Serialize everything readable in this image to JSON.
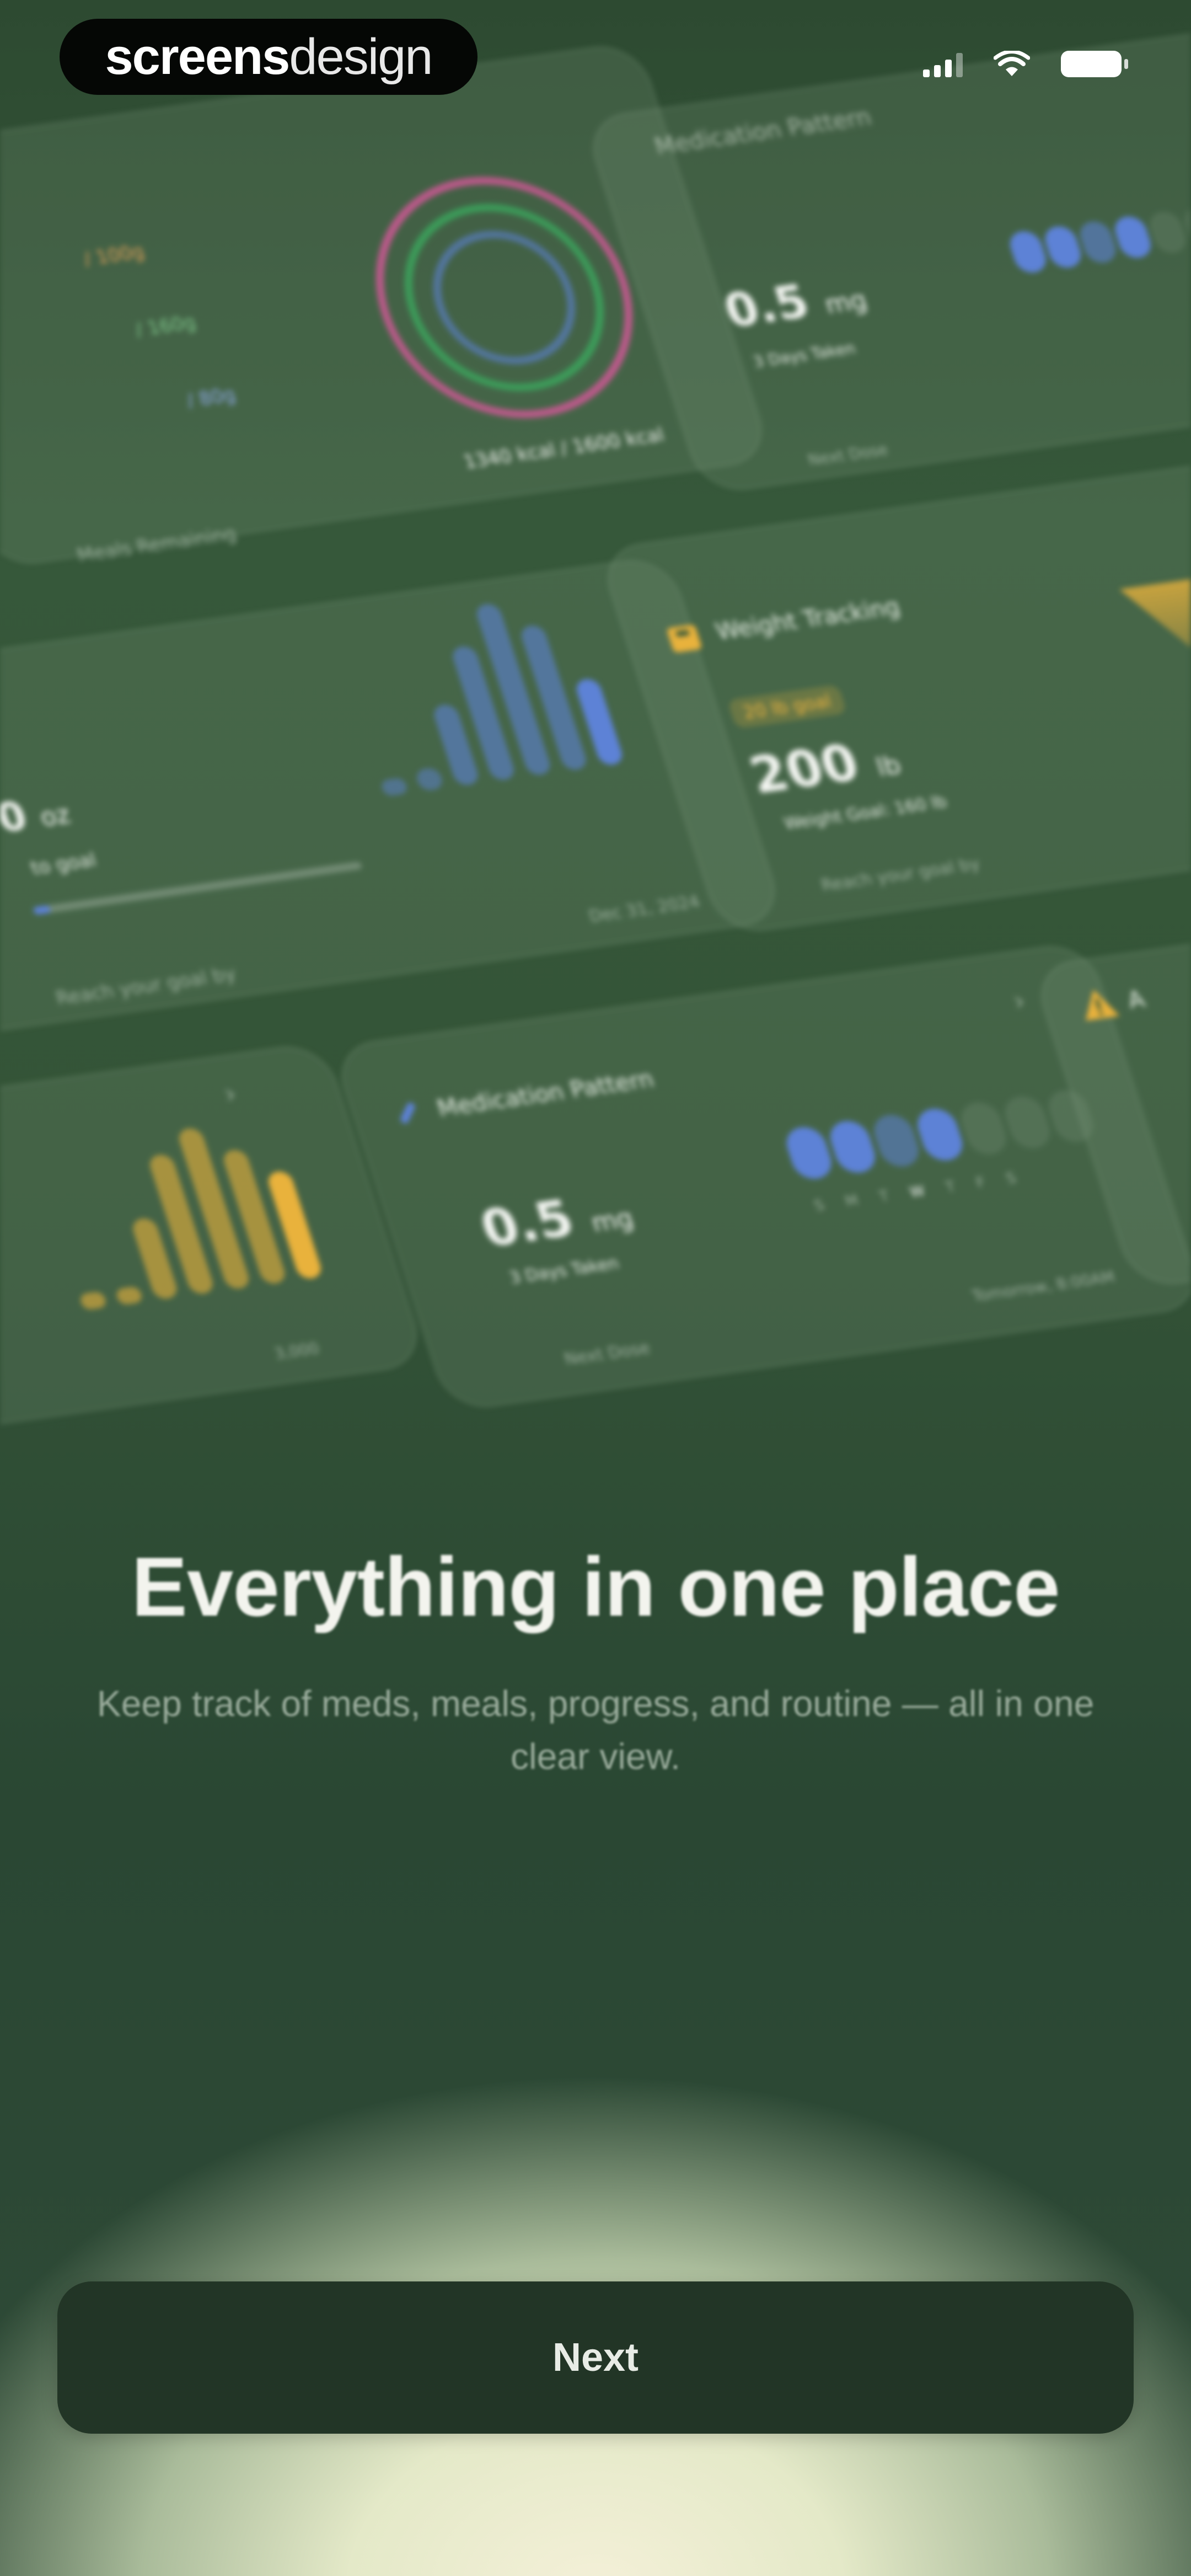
{
  "brand": {
    "part1": "screens",
    "part2": "design"
  },
  "status_bar": {
    "icons": [
      "signal-icon",
      "wifi-icon",
      "battery-icon"
    ]
  },
  "cards": {
    "macros": {
      "rows": [
        "/ 100g",
        "/ 160g",
        "/ 80g"
      ],
      "footer": "Meals Remaining",
      "goal": "1340 kcal / 1600 kcal"
    },
    "med_top": {
      "title": "Medication Pattern",
      "value": "0.5",
      "unit": "mg",
      "sub": "3 Days Taken",
      "footer": "Next Dose"
    },
    "weight": {
      "title": "Weight Tracking",
      "tag": "20 lb goal",
      "value": "200",
      "unit": "lb",
      "sub": "Weight Goal: 160 lb",
      "footer": "Reach your goal by"
    },
    "water": {
      "value": "",
      "unit": "oz",
      "sub": "to goal",
      "footer": "Reach your goal by",
      "date": "Dec 31, 2024"
    },
    "med_main": {
      "title": "Medication Pattern",
      "value": "0.5",
      "unit": "mg",
      "sub": "3 Days Taken",
      "footer": "Next Dose",
      "next": "Tomorrow, 8:00AM",
      "days": [
        "S",
        "M",
        "T",
        "W",
        "T",
        "F",
        "S"
      ]
    },
    "activity": {
      "footer": "3,000"
    },
    "alert": {
      "title": "A"
    }
  },
  "colors": {
    "accent_blue": "#5d82d6",
    "accent_yellow": "#e9b23c",
    "accent_pink": "#d8579b",
    "accent_green": "#3bb463"
  },
  "headline": "Everything in one place",
  "subtext": "Keep track of meds, meals, progress, and routine — all in one clear view.",
  "button": {
    "label": "Next"
  }
}
